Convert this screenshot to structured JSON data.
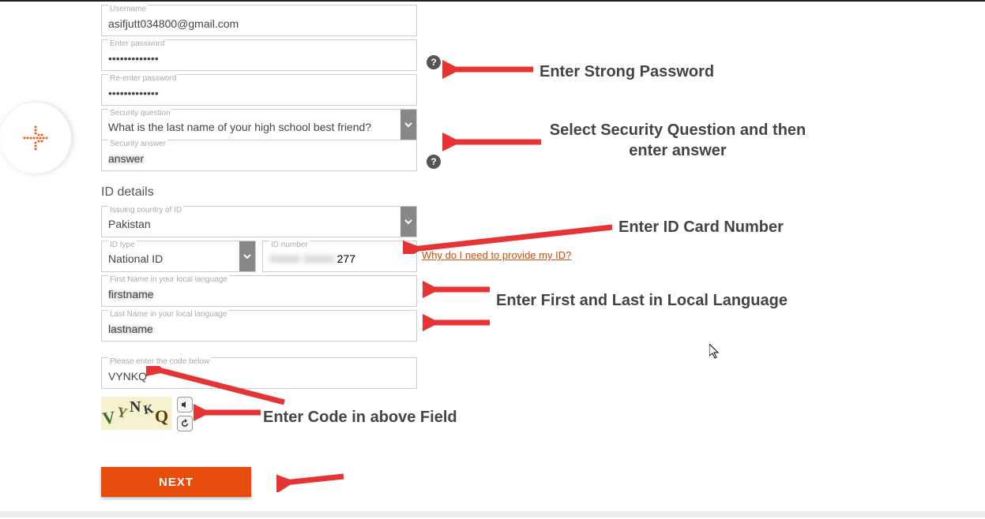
{
  "labels": {
    "username": "Username",
    "password": "Enter password",
    "repassword": "Re-enter password",
    "secq": "Security question",
    "seca": "Security answer",
    "id_section": "ID details",
    "country": "Issuing country of ID",
    "idtype": "ID type",
    "idnumber": "ID number",
    "firstname": "First Name in your local language",
    "lastname": "Last Name in your local language",
    "captcha": "Please enter the code below"
  },
  "values": {
    "username": "asifjutt034800@gmail.com",
    "password": "•••••••••••••",
    "repassword": "•••••••••••••",
    "secq": "What is the last name of your high school best friend?",
    "seca": "blurred",
    "country": "Pakistan",
    "idtype": "National ID",
    "idnumber_suffix": "277",
    "firstname": "blurred",
    "lastname": "blurred",
    "captcha": "VYNKQ"
  },
  "link_idhelp": "Why do I need to provide my ID?",
  "captcha_image": "VYNKQ",
  "next_button": "NEXT",
  "annotations": {
    "a1": "Enter Strong Password",
    "a2": "Select Security Question and then enter answer",
    "a3": "Enter ID Card Number",
    "a4": "Enter First and Last in Local Language",
    "a5": "Enter Code in above Field"
  }
}
